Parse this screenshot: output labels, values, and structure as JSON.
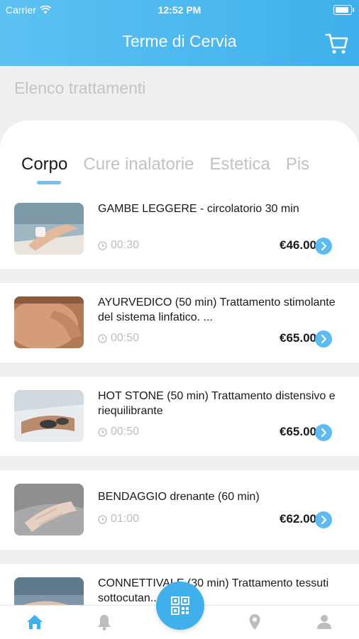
{
  "status_bar": {
    "carrier": "Carrier",
    "time": "12:52 PM"
  },
  "header": {
    "title": "Terme di Cervia",
    "cart_icon": "cart-icon"
  },
  "section_title": "Elenco trattamenti",
  "tabs": [
    {
      "label": "Corpo",
      "active": true
    },
    {
      "label": "Cure inalatorie",
      "active": false
    },
    {
      "label": "Estetica",
      "active": false
    },
    {
      "label": "Pis",
      "active": false
    }
  ],
  "treatments": [
    {
      "title": "GAMBE LEGGERE - circolatorio 30 min",
      "duration": "00:30",
      "price": "€46.00"
    },
    {
      "title": "AYURVEDICO (50 min) Trattamento stimolante del sistema linfatico. ...",
      "duration": "00:50",
      "price": "€65.00"
    },
    {
      "title": "HOT STONE (50 min) Trattamento distensivo e riequilibrante",
      "duration": "00:50",
      "price": "€65.00"
    },
    {
      "title": "BENDAGGIO drenante (60 min)",
      "duration": "01:00",
      "price": "€62.00"
    },
    {
      "title": "CONNETTIVALE (30 min) Trattamento tessuti sottocutan...",
      "duration": "",
      "price": ""
    }
  ],
  "tab_bar": {
    "icons": [
      "home-icon",
      "bell-icon",
      "qr-code-icon",
      "location-pin-icon",
      "user-icon"
    ]
  },
  "colors": {
    "primary": "#3fb0ec",
    "accent": "#5cbbef",
    "tab_inactive": "#c2c2c2"
  }
}
